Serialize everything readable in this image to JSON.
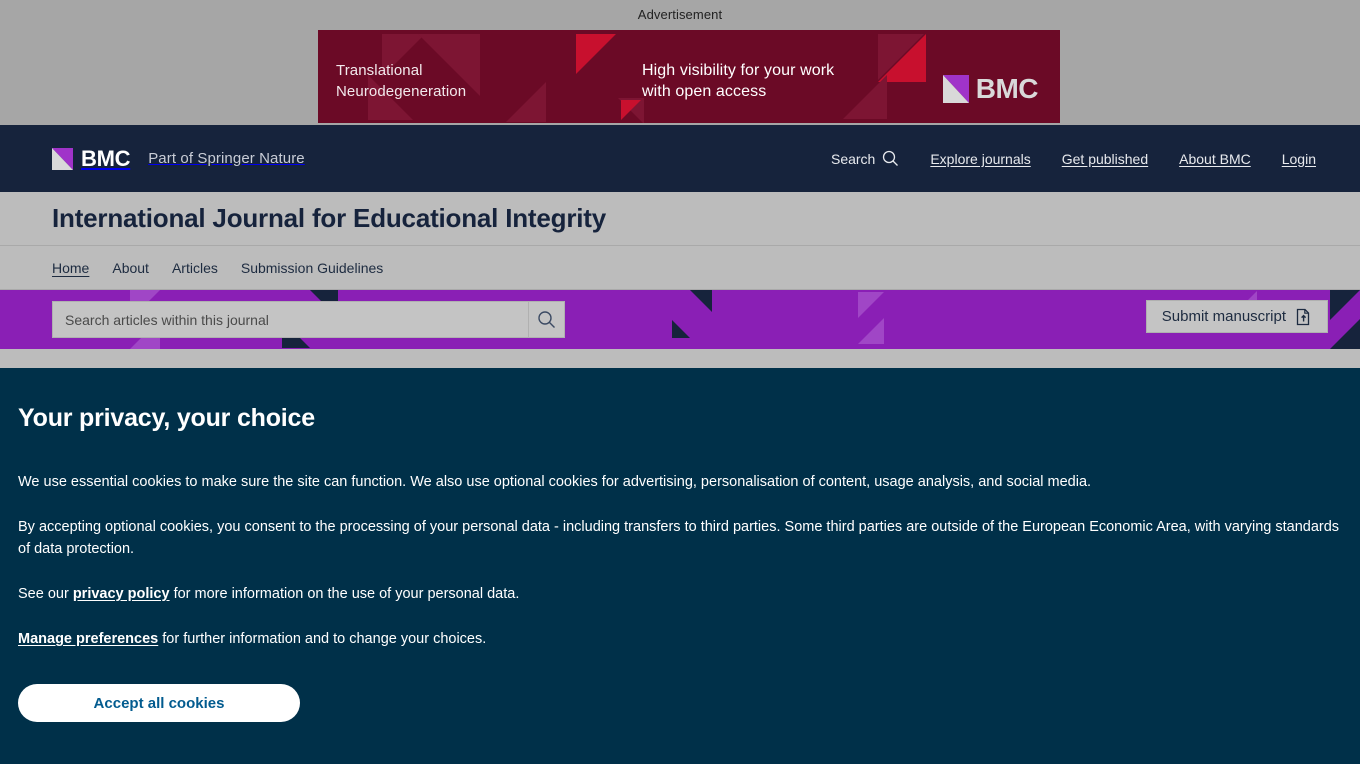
{
  "advertisement": {
    "label": "Advertisement",
    "journal_name_line1": "Translational",
    "journal_name_line2": "Neurodegeneration",
    "tagline_line1": "High visibility for your work",
    "tagline_line2": "with open access",
    "logo_text": "BMC",
    "background_color": "#6b0a26",
    "accent_color": "#c8102e"
  },
  "main_nav": {
    "logo_text": "BMC",
    "tagline": "Part of Springer Nature",
    "search_label": "Search",
    "links": [
      {
        "label": "Explore journals"
      },
      {
        "label": "Get published"
      },
      {
        "label": "About BMC"
      },
      {
        "label": "Login"
      }
    ],
    "background_color": "#16233c"
  },
  "journal": {
    "title": "International Journal for Educational Integrity",
    "nav": [
      {
        "label": "Home",
        "active": true
      },
      {
        "label": "About",
        "active": false
      },
      {
        "label": "Articles",
        "active": false
      },
      {
        "label": "Submission Guidelines",
        "active": false
      }
    ]
  },
  "search_band": {
    "placeholder": "Search articles within this journal",
    "value": "",
    "submit_label": "Submit manuscript",
    "background_color": "#8a1fb5"
  },
  "cookie_banner": {
    "heading": "Your privacy, your choice",
    "paragraph1": "We use essential cookies to make sure the site can function. We also use optional cookies for advertising, personalisation of content, usage analysis, and social media.",
    "paragraph2": "By accepting optional cookies, you consent to the processing of your personal data - including transfers to third parties. Some third parties are outside of the European Economic Area, with varying standards of data protection.",
    "see_our_prefix": "See our ",
    "privacy_policy_link": "privacy policy",
    "see_our_suffix": " for more information on the use of your personal data.",
    "manage_preferences_link": "Manage preferences",
    "manage_preferences_suffix": " for further information and to change your choices.",
    "accept_label": "Accept all cookies",
    "background_color": "#003049",
    "button_text_color": "#025b8f"
  }
}
